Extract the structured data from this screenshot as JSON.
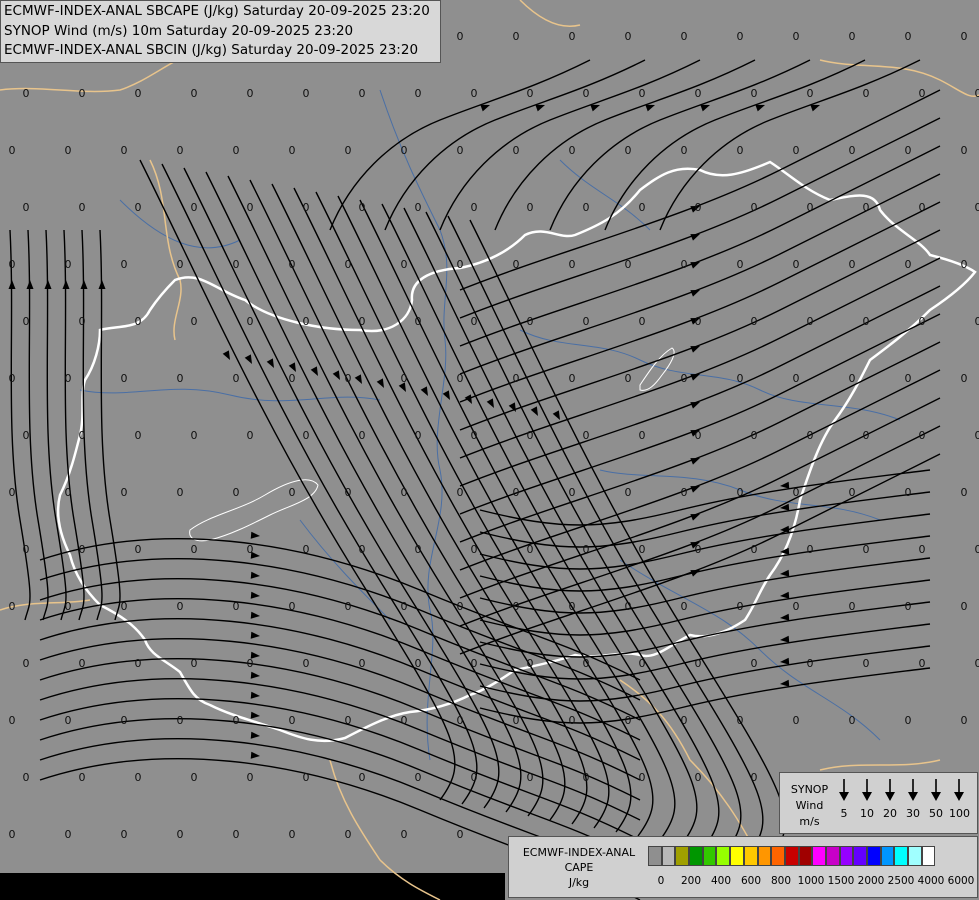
{
  "header": {
    "line1": "ECMWF-INDEX-ANAL SBCAPE (J/kg) Saturday 20-09-2025 23:20",
    "line2": "SYNOP Wind (m/s) 10m Saturday 20-09-2025 23:20",
    "line3": "ECMWF-INDEX-ANAL SBCIN (J/kg) Saturday 20-09-2025 23:20"
  },
  "map": {
    "background_color": "#8f8f8f",
    "border_color": "#ffffff",
    "neighbour_border_color": "#e8c48c",
    "river_color": "#4a6fa5",
    "streamline_color": "#000000",
    "grid_value": "0"
  },
  "synop_legend": {
    "title_lines": [
      "SYNOP",
      "Wind",
      "m/s"
    ],
    "speeds": [
      "5",
      "10",
      "20",
      "30",
      "50",
      "100"
    ]
  },
  "cape_legend": {
    "title_lines": [
      "ECMWF-INDEX-ANAL",
      "CAPE",
      "J/kg"
    ],
    "ticks": [
      "0",
      "200",
      "400",
      "600",
      "800",
      "1000",
      "1500",
      "2000",
      "2500",
      "4000",
      "6000"
    ],
    "colors": [
      "#8f8f8f",
      "#b8b8b8",
      "#a0a000",
      "#009600",
      "#32c800",
      "#96ff00",
      "#ffff00",
      "#ffc800",
      "#ff9600",
      "#ff6400",
      "#c80000",
      "#a00000",
      "#ff00ff",
      "#c800c8",
      "#9600ff",
      "#6400ff",
      "#0000ff",
      "#0096ff",
      "#00ffff",
      "#a0ffff",
      "#ffffff"
    ]
  }
}
